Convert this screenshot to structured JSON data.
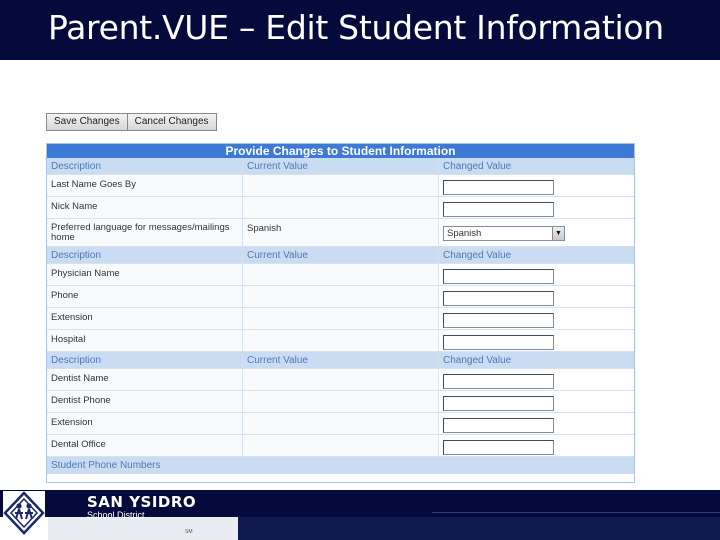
{
  "slide": {
    "title": "Parent.VUE – Edit Student Information"
  },
  "toolbar": {
    "save_label": "Save Changes",
    "cancel_label": "Cancel Changes"
  },
  "panel": {
    "title": "Provide Changes to Student Information",
    "columns": {
      "description": "Description",
      "current": "Current Value",
      "changed": "Changed Value"
    },
    "group1": {
      "rows": [
        {
          "label": "Last Name Goes By",
          "current": "",
          "input": "",
          "type": "text"
        },
        {
          "label": "Nick Name",
          "current": "",
          "input": "",
          "type": "text"
        },
        {
          "label": "Preferred language for messages/mailings home",
          "current": "Spanish",
          "selected": "Spanish",
          "type": "select"
        }
      ]
    },
    "group2": {
      "rows": [
        {
          "label": "Physician Name",
          "current": "",
          "input": ""
        },
        {
          "label": "Phone",
          "current": "",
          "input": ""
        },
        {
          "label": "Extension",
          "current": "",
          "input": ""
        },
        {
          "label": "Hospital",
          "current": "",
          "input": ""
        }
      ]
    },
    "group3": {
      "rows": [
        {
          "label": "Dentist Name",
          "current": "",
          "input": ""
        },
        {
          "label": "Dentist Phone",
          "current": "",
          "input": ""
        },
        {
          "label": "Extension",
          "current": "",
          "input": ""
        },
        {
          "label": "Dental Office",
          "current": "",
          "input": ""
        }
      ]
    },
    "section_footer": "Student Phone Numbers"
  },
  "footer": {
    "district_name": "SAN YSIDRO",
    "district_sub": "School District",
    "tiny_mark": "SM"
  },
  "colors": {
    "title_bar": "#050a3c",
    "panel_header": "#3d7ad6",
    "column_header": "#c9dcf2"
  }
}
